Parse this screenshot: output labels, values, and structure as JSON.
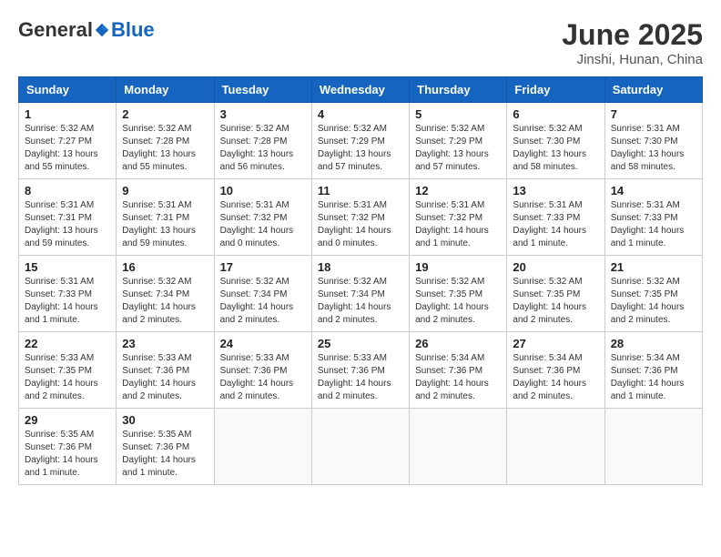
{
  "header": {
    "logo_general": "General",
    "logo_blue": "Blue",
    "month_year": "June 2025",
    "location": "Jinshi, Hunan, China"
  },
  "weekdays": [
    "Sunday",
    "Monday",
    "Tuesday",
    "Wednesday",
    "Thursday",
    "Friday",
    "Saturday"
  ],
  "weeks": [
    [
      {
        "day": "1",
        "info": "Sunrise: 5:32 AM\nSunset: 7:27 PM\nDaylight: 13 hours and 55 minutes."
      },
      {
        "day": "2",
        "info": "Sunrise: 5:32 AM\nSunset: 7:28 PM\nDaylight: 13 hours and 55 minutes."
      },
      {
        "day": "3",
        "info": "Sunrise: 5:32 AM\nSunset: 7:28 PM\nDaylight: 13 hours and 56 minutes."
      },
      {
        "day": "4",
        "info": "Sunrise: 5:32 AM\nSunset: 7:29 PM\nDaylight: 13 hours and 57 minutes."
      },
      {
        "day": "5",
        "info": "Sunrise: 5:32 AM\nSunset: 7:29 PM\nDaylight: 13 hours and 57 minutes."
      },
      {
        "day": "6",
        "info": "Sunrise: 5:32 AM\nSunset: 7:30 PM\nDaylight: 13 hours and 58 minutes."
      },
      {
        "day": "7",
        "info": "Sunrise: 5:31 AM\nSunset: 7:30 PM\nDaylight: 13 hours and 58 minutes."
      }
    ],
    [
      {
        "day": "8",
        "info": "Sunrise: 5:31 AM\nSunset: 7:31 PM\nDaylight: 13 hours and 59 minutes."
      },
      {
        "day": "9",
        "info": "Sunrise: 5:31 AM\nSunset: 7:31 PM\nDaylight: 13 hours and 59 minutes."
      },
      {
        "day": "10",
        "info": "Sunrise: 5:31 AM\nSunset: 7:32 PM\nDaylight: 14 hours and 0 minutes."
      },
      {
        "day": "11",
        "info": "Sunrise: 5:31 AM\nSunset: 7:32 PM\nDaylight: 14 hours and 0 minutes."
      },
      {
        "day": "12",
        "info": "Sunrise: 5:31 AM\nSunset: 7:32 PM\nDaylight: 14 hours and 1 minute."
      },
      {
        "day": "13",
        "info": "Sunrise: 5:31 AM\nSunset: 7:33 PM\nDaylight: 14 hours and 1 minute."
      },
      {
        "day": "14",
        "info": "Sunrise: 5:31 AM\nSunset: 7:33 PM\nDaylight: 14 hours and 1 minute."
      }
    ],
    [
      {
        "day": "15",
        "info": "Sunrise: 5:31 AM\nSunset: 7:33 PM\nDaylight: 14 hours and 1 minute."
      },
      {
        "day": "16",
        "info": "Sunrise: 5:32 AM\nSunset: 7:34 PM\nDaylight: 14 hours and 2 minutes."
      },
      {
        "day": "17",
        "info": "Sunrise: 5:32 AM\nSunset: 7:34 PM\nDaylight: 14 hours and 2 minutes."
      },
      {
        "day": "18",
        "info": "Sunrise: 5:32 AM\nSunset: 7:34 PM\nDaylight: 14 hours and 2 minutes."
      },
      {
        "day": "19",
        "info": "Sunrise: 5:32 AM\nSunset: 7:35 PM\nDaylight: 14 hours and 2 minutes."
      },
      {
        "day": "20",
        "info": "Sunrise: 5:32 AM\nSunset: 7:35 PM\nDaylight: 14 hours and 2 minutes."
      },
      {
        "day": "21",
        "info": "Sunrise: 5:32 AM\nSunset: 7:35 PM\nDaylight: 14 hours and 2 minutes."
      }
    ],
    [
      {
        "day": "22",
        "info": "Sunrise: 5:33 AM\nSunset: 7:35 PM\nDaylight: 14 hours and 2 minutes."
      },
      {
        "day": "23",
        "info": "Sunrise: 5:33 AM\nSunset: 7:36 PM\nDaylight: 14 hours and 2 minutes."
      },
      {
        "day": "24",
        "info": "Sunrise: 5:33 AM\nSunset: 7:36 PM\nDaylight: 14 hours and 2 minutes."
      },
      {
        "day": "25",
        "info": "Sunrise: 5:33 AM\nSunset: 7:36 PM\nDaylight: 14 hours and 2 minutes."
      },
      {
        "day": "26",
        "info": "Sunrise: 5:34 AM\nSunset: 7:36 PM\nDaylight: 14 hours and 2 minutes."
      },
      {
        "day": "27",
        "info": "Sunrise: 5:34 AM\nSunset: 7:36 PM\nDaylight: 14 hours and 2 minutes."
      },
      {
        "day": "28",
        "info": "Sunrise: 5:34 AM\nSunset: 7:36 PM\nDaylight: 14 hours and 1 minute."
      }
    ],
    [
      {
        "day": "29",
        "info": "Sunrise: 5:35 AM\nSunset: 7:36 PM\nDaylight: 14 hours and 1 minute."
      },
      {
        "day": "30",
        "info": "Sunrise: 5:35 AM\nSunset: 7:36 PM\nDaylight: 14 hours and 1 minute."
      },
      {
        "day": "",
        "info": ""
      },
      {
        "day": "",
        "info": ""
      },
      {
        "day": "",
        "info": ""
      },
      {
        "day": "",
        "info": ""
      },
      {
        "day": "",
        "info": ""
      }
    ]
  ]
}
